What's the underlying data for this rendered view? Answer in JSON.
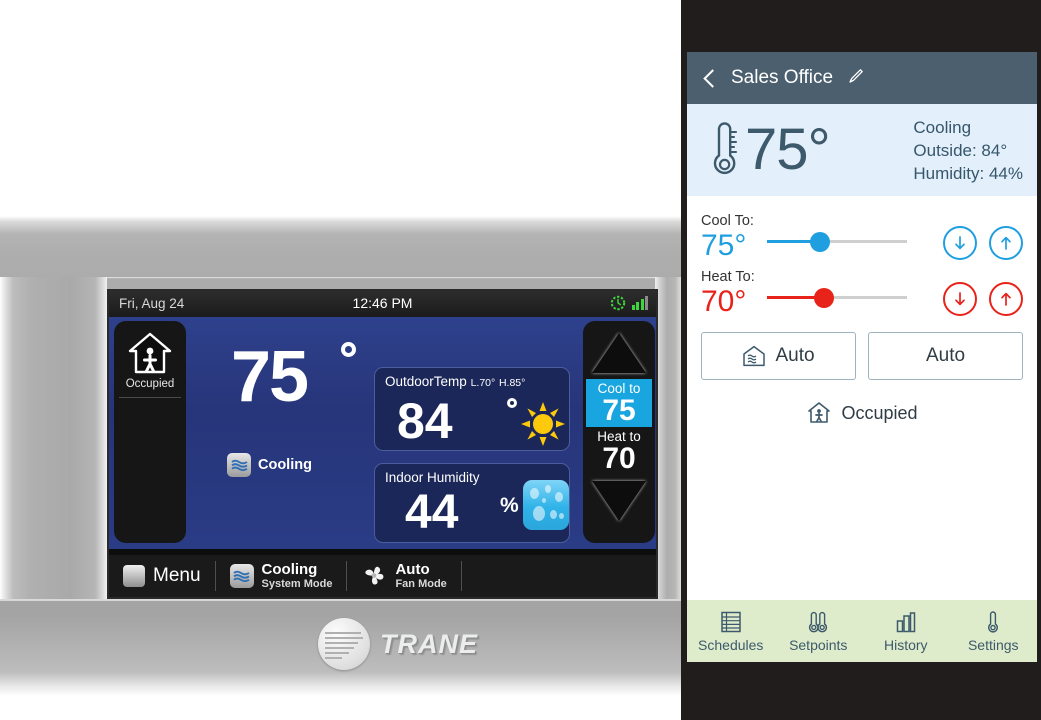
{
  "device": {
    "status_bar": {
      "date": "Fri, Aug 24",
      "time": "12:46 PM",
      "clock_icon": "clock-icon",
      "signal_icon": "signal-bars-icon"
    },
    "occupancy": {
      "icon": "house-occupied-icon",
      "label": "Occupied"
    },
    "indoor_temp": "75",
    "system_status": {
      "label": "Cooling",
      "icon": "cooling-waves-icon"
    },
    "outdoor_card": {
      "title": "OutdoorTemp",
      "low": "L.70°",
      "high": "H.85°",
      "value": "84",
      "weather_icon": "sun-icon"
    },
    "humidity_card": {
      "title": "Indoor Humidity",
      "value": "44",
      "unit": "%",
      "icon": "water-droplets-icon"
    },
    "setpoints": {
      "up_icon": "triangle-up-icon",
      "down_icon": "triangle-down-icon",
      "cool_label": "Cool to",
      "cool_value": "75",
      "heat_label": "Heat to",
      "heat_value": "70"
    },
    "footer": {
      "menu_label": "Menu",
      "menu_icon": "menu-stack-icon",
      "system_mode_value": "Cooling",
      "system_mode_label": "System Mode",
      "system_mode_icon": "cooling-waves-icon",
      "fan_mode_value": "Auto",
      "fan_mode_label": "Fan Mode",
      "fan_mode_icon": "fan-icon"
    },
    "brand": "TRANE"
  },
  "app": {
    "header": {
      "back_icon": "back-chevron-icon",
      "title": "Sales Office",
      "edit_icon": "pencil-icon"
    },
    "summary": {
      "thermometer_icon": "thermometer-icon",
      "temperature": "75°",
      "status": "Cooling",
      "outside": "Outside: 84°",
      "humidity": "Humidity: 44%"
    },
    "cool": {
      "label": "Cool To:",
      "value": "75°",
      "slider_percent": 38,
      "color": "#1f9fe0",
      "decrease_icon": "arrow-down-icon",
      "increase_icon": "arrow-up-icon"
    },
    "heat": {
      "label": "Heat To:",
      "value": "70°",
      "slider_percent": 41,
      "color": "#e8231a",
      "decrease_icon": "arrow-down-icon",
      "increase_icon": "arrow-up-icon"
    },
    "system_mode_button": {
      "label": "Auto",
      "icon": "house-waves-icon"
    },
    "fan_mode_button": {
      "label": "Auto"
    },
    "occupancy": {
      "icon": "house-occupied-icon",
      "label": "Occupied"
    },
    "nav": [
      {
        "label": "Schedules",
        "icon": "schedule-grid-icon"
      },
      {
        "label": "Setpoints",
        "icon": "two-thermometers-icon"
      },
      {
        "label": "History",
        "icon": "bar-chart-icon"
      },
      {
        "label": "Settings",
        "icon": "thermometer-icon"
      }
    ],
    "colors": {
      "header": "#4c5f6e",
      "summary_bg": "#e3f0fb",
      "nav_bg": "#dfeccb",
      "accent_cool": "#1f9fe0",
      "accent_heat": "#e8231a"
    }
  }
}
